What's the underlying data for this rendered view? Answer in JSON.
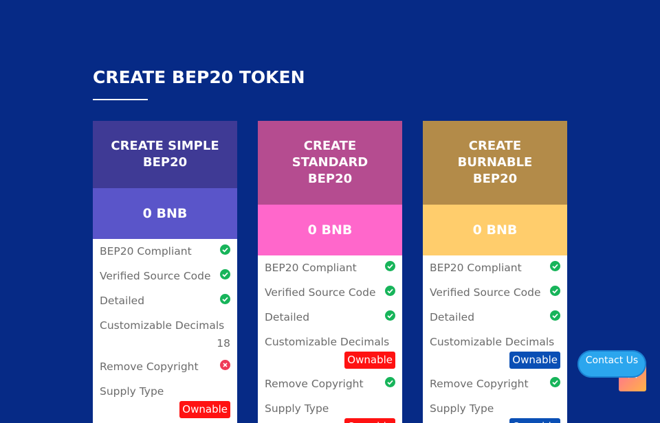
{
  "section": {
    "title": "CREATE BEP20 TOKEN"
  },
  "contact": {
    "label": "Contact Us"
  },
  "cards": [
    {
      "title": "CREATE SIMPLE BEP20",
      "price": "0 BNB",
      "colors": {
        "header": "#3f3a95",
        "price": "#5a55c9",
        "badge": "#0a4fb5"
      },
      "features": [
        {
          "label": "BEP20 Compliant",
          "type": "check"
        },
        {
          "label": "Verified Source Code",
          "type": "check"
        },
        {
          "label": "Detailed",
          "type": "check"
        },
        {
          "label": "Customizable Decimals",
          "type": "text",
          "value": "18"
        },
        {
          "label": "Remove Copyright",
          "type": "cross"
        },
        {
          "label": "Supply Type",
          "type": "badge",
          "value": "Ownable",
          "badge_color": "#ff1212"
        }
      ]
    },
    {
      "title": "CREATE STANDARD BEP20",
      "price": "0 BNB",
      "colors": {
        "header": "#b54c90",
        "price": "#ff67cb",
        "badge": "#ff1212"
      },
      "features": [
        {
          "label": "BEP20 Compliant",
          "type": "check"
        },
        {
          "label": "Verified Source Code",
          "type": "check"
        },
        {
          "label": "Detailed",
          "type": "check"
        },
        {
          "label": "Customizable Decimals",
          "type": "badge",
          "value": "Ownable",
          "badge_color": "#ff1212"
        },
        {
          "label": "Remove Copyright",
          "type": "check"
        },
        {
          "label": "Supply Type",
          "type": "badge",
          "value": "Ownable",
          "badge_color": "#ff1212"
        }
      ]
    },
    {
      "title": "CREATE BURNABLE BEP20",
      "price": "0 BNB",
      "colors": {
        "header": "#b38b49",
        "price": "#ffcd6c",
        "badge": "#0a4fb5"
      },
      "features": [
        {
          "label": "BEP20 Compliant",
          "type": "check"
        },
        {
          "label": "Verified Source Code",
          "type": "check"
        },
        {
          "label": "Detailed",
          "type": "check"
        },
        {
          "label": "Customizable Decimals",
          "type": "badge",
          "value": "Ownable",
          "badge_color": "#0a4fb5"
        },
        {
          "label": "Remove Copyright",
          "type": "check"
        },
        {
          "label": "Supply Type",
          "type": "badge",
          "value": "Ownable",
          "badge_color": "#0a4fb5"
        }
      ]
    }
  ],
  "icons": {
    "check": "check-circle-icon",
    "cross": "cross-circle-icon",
    "scroll": "arrow-up-icon"
  },
  "status_colors": {
    "check": "#17b45a",
    "cross": "#ef3b57"
  }
}
